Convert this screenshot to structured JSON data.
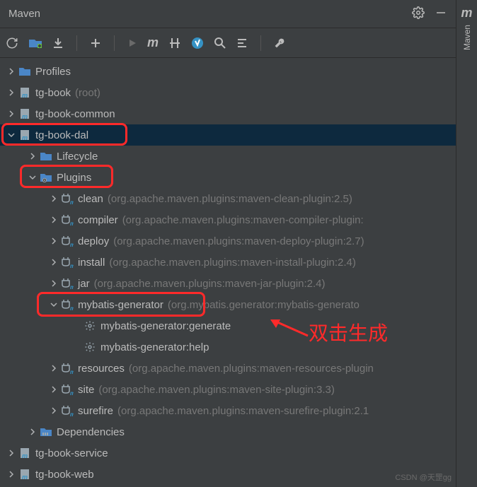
{
  "title": "Maven",
  "rightbar": {
    "glyph": "m",
    "label": "Maven"
  },
  "tree": {
    "profiles": "Profiles",
    "tg_book": {
      "name": "tg-book",
      "hint": "(root)"
    },
    "tg_book_common": "tg-book-common",
    "tg_book_dal": "tg-book-dal",
    "lifecycle": "Lifecycle",
    "plugins": "Plugins",
    "clean": {
      "name": "clean",
      "hint": "(org.apache.maven.plugins:maven-clean-plugin:2.5)"
    },
    "compiler": {
      "name": "compiler",
      "hint": "(org.apache.maven.plugins:maven-compiler-plugin:"
    },
    "deploy": {
      "name": "deploy",
      "hint": "(org.apache.maven.plugins:maven-deploy-plugin:2.7)"
    },
    "install": {
      "name": "install",
      "hint": "(org.apache.maven.plugins:maven-install-plugin:2.4)"
    },
    "jar": {
      "name": "jar",
      "hint": "(org.apache.maven.plugins:maven-jar-plugin:2.4)"
    },
    "mybatis": {
      "name": "mybatis-generator",
      "hint": "(org.mybatis.generator:mybatis-generato"
    },
    "goal_generate": "mybatis-generator:generate",
    "goal_help": "mybatis-generator:help",
    "resources": {
      "name": "resources",
      "hint": "(org.apache.maven.plugins:maven-resources-plugin"
    },
    "site": {
      "name": "site",
      "hint": "(org.apache.maven.plugins:maven-site-plugin:3.3)"
    },
    "surefire": {
      "name": "surefire",
      "hint": "(org.apache.maven.plugins:maven-surefire-plugin:2.1"
    },
    "dependencies": "Dependencies",
    "tg_book_service": "tg-book-service",
    "tg_book_web": "tg-book-web"
  },
  "annotation": "双击生成",
  "watermark": "CSDN @天罡gg"
}
